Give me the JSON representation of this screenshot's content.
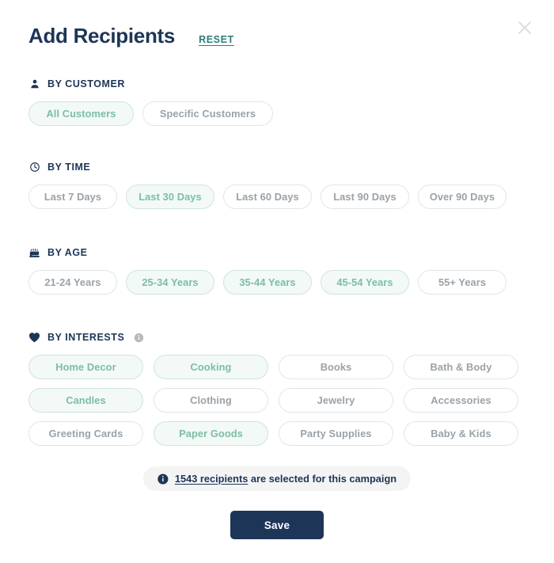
{
  "modal": {
    "title": "Add Recipients",
    "reset_label": "RESET",
    "close_icon": "close-icon"
  },
  "colors": {
    "navy": "#1d3557",
    "teal_link": "#2a7d7b",
    "pill_selected_text": "#7bbfa3",
    "pill_selected_bg": "#f2f9f6",
    "pill_selected_border": "#cfe6da",
    "pill_text": "#9aa2a8",
    "pill_border": "#e2e5e7",
    "banner_bg": "#f4f4f5",
    "save_bg": "#1d3557"
  },
  "sections": {
    "customer": {
      "label": "BY CUSTOMER",
      "icon": "person-icon",
      "options": [
        {
          "label": "All Customers",
          "selected": true
        },
        {
          "label": "Specific Customers",
          "selected": false
        }
      ]
    },
    "time": {
      "label": "BY TIME",
      "icon": "clock-icon",
      "options": [
        {
          "label": "Last 7 Days",
          "selected": false
        },
        {
          "label": "Last 30 Days",
          "selected": true
        },
        {
          "label": "Last 60 Days",
          "selected": false
        },
        {
          "label": "Last 90 Days",
          "selected": false
        },
        {
          "label": "Over 90 Days",
          "selected": false
        }
      ]
    },
    "age": {
      "label": "BY AGE",
      "icon": "birthday-cake-icon",
      "options": [
        {
          "label": "21-24 Years",
          "selected": false
        },
        {
          "label": "25-34 Years",
          "selected": true
        },
        {
          "label": "35-44 Years",
          "selected": true
        },
        {
          "label": "45-54 Years",
          "selected": true
        },
        {
          "label": "55+ Years",
          "selected": false
        }
      ]
    },
    "interests": {
      "label": "BY INTERESTS",
      "icon": "heart-icon",
      "info_icon": "info-icon",
      "options": [
        {
          "label": "Home Decor",
          "selected": true
        },
        {
          "label": "Cooking",
          "selected": true
        },
        {
          "label": "Books",
          "selected": false
        },
        {
          "label": "Bath & Body",
          "selected": false
        },
        {
          "label": "Candles",
          "selected": true
        },
        {
          "label": "Clothing",
          "selected": false
        },
        {
          "label": "Jewelry",
          "selected": false
        },
        {
          "label": "Accessories",
          "selected": false
        },
        {
          "label": "Greeting Cards",
          "selected": false
        },
        {
          "label": "Paper Goods",
          "selected": true
        },
        {
          "label": "Party Supplies",
          "selected": false
        },
        {
          "label": "Baby & Kids",
          "selected": false
        }
      ]
    }
  },
  "footer": {
    "banner_icon": "info-filled-icon",
    "recipients_count": "1543 recipients",
    "recipients_rest": " are selected for this campaign",
    "save_label": "Save"
  }
}
